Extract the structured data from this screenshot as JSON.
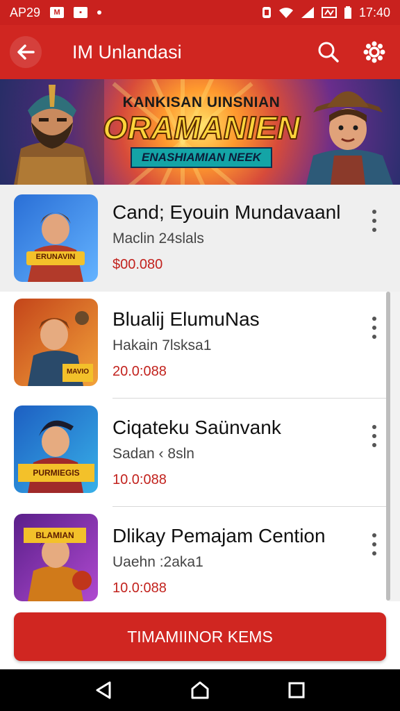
{
  "status_bar": {
    "carrier": "AP29",
    "time": "17:40"
  },
  "app_bar": {
    "title": "IM Unlandasi"
  },
  "banner": {
    "top_text": "KANKISAN UINSNIAN",
    "main_text": "ORAMANIEN",
    "sub_text": "ENASHIAMIAN NEEK"
  },
  "items": [
    {
      "title": "Cand; Eyouin Mundavaanl",
      "subtitle": "Maclin 24slals",
      "price": "$00.080",
      "thumb_text": "ERUNAVIN"
    },
    {
      "title": "Blualij ElumuNas",
      "subtitle": "Hakain 7lsksa1",
      "price": "20.0:088",
      "thumb_text": "MAVIO"
    },
    {
      "title": "Ciqateku Saünvank",
      "subtitle": "Sadan ‹ 8sln",
      "price": "10.0:088",
      "thumb_text": "PURMIEGIS"
    },
    {
      "title": "Dlikay Pemajam Cention",
      "subtitle": "Uaehn :2aka1",
      "price": "10.0:088",
      "thumb_text": "BLAMIAN"
    }
  ],
  "cta": {
    "label": "TIMAMIINOR KEMS"
  },
  "colors": {
    "primary": "#d02621",
    "price": "#c2221d"
  },
  "icons": [
    "back-arrow-icon",
    "search-icon",
    "settings-gear-icon",
    "more-vertical-icon",
    "nav-back-icon",
    "nav-home-icon",
    "nav-recents-icon"
  ]
}
